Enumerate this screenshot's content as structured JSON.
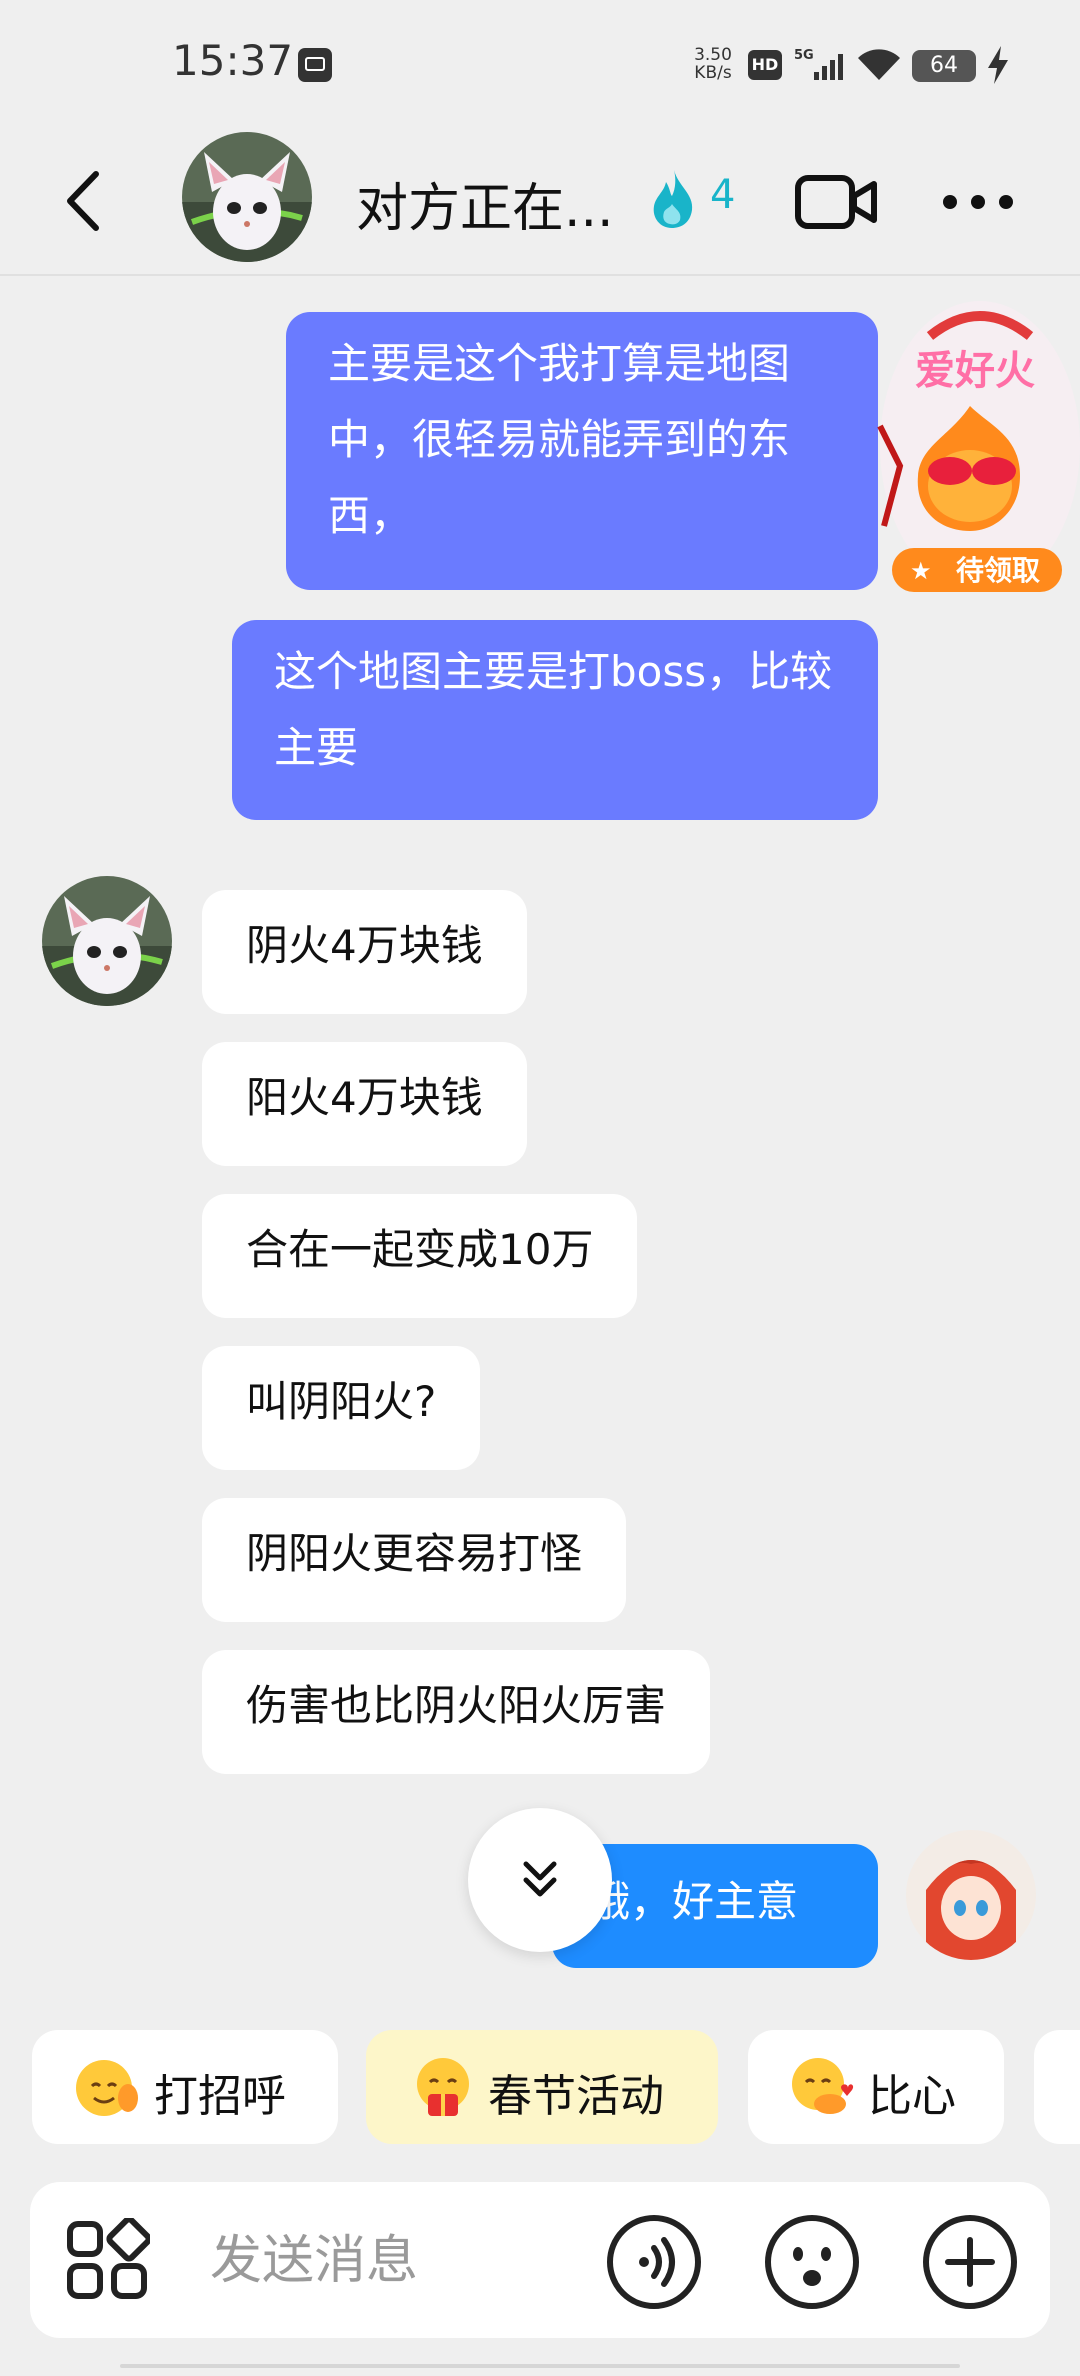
{
  "status_bar": {
    "time": "15:37",
    "net_speed_value": "3.50",
    "net_speed_unit": "KB/s",
    "hd_label": "HD",
    "battery": "64"
  },
  "header": {
    "title": "对方正在...",
    "flame_count": "4"
  },
  "messages_out": [
    "主要是这个我打算是地图中，很轻易就能弄到的东西，",
    "这个地图主要是打boss，比较主要"
  ],
  "messages_in": [
    "阴火4万块钱",
    "阳火4万块钱",
    "合在一起变成10万",
    "叫阴阳火?",
    "阴阳火更容易打怪",
    "伤害也比阴火阳火厉害"
  ],
  "last_out": "哦，好主意",
  "sticker": {
    "title": "爱好火",
    "badge": "待领取"
  },
  "quick_replies": [
    {
      "label": "打招呼"
    },
    {
      "label": "春节活动"
    },
    {
      "label": "比心"
    }
  ],
  "input": {
    "placeholder": "发送消息"
  },
  "colors": {
    "outgoing_bubble": "#6a7bff",
    "outgoing_bubble_alt": "#1e8cff",
    "flame": "#19b4c9",
    "highlight_chip": "#fdf6c9"
  }
}
